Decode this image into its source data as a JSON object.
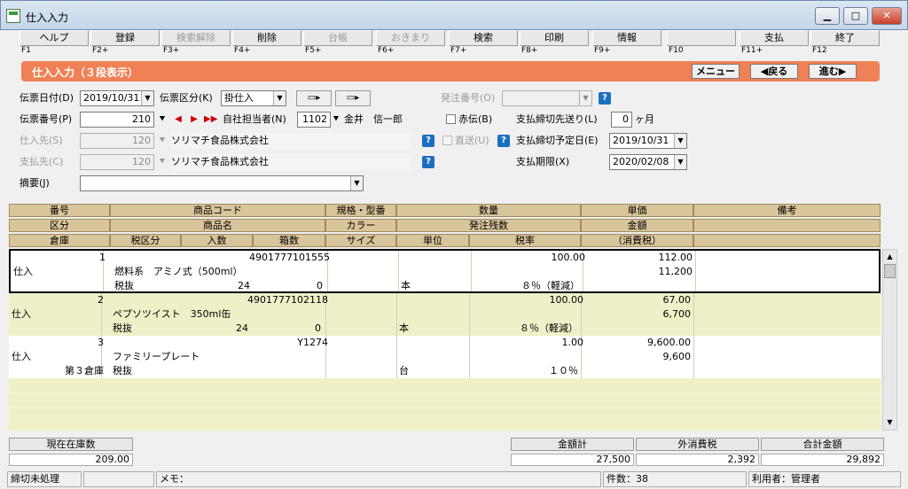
{
  "window": {
    "title": "仕入入力"
  },
  "fkeys": [
    {
      "label": "ヘルプ",
      "key": "F1",
      "enabled": true
    },
    {
      "label": "登録",
      "key": "F2+",
      "enabled": true
    },
    {
      "label": "検索解除",
      "key": "F3+",
      "enabled": false
    },
    {
      "label": "削除",
      "key": "F4+",
      "enabled": true
    },
    {
      "label": "台帳",
      "key": "F5+",
      "enabled": false
    },
    {
      "label": "おきまり",
      "key": "F6+",
      "enabled": false
    },
    {
      "label": "検索",
      "key": "F7+",
      "enabled": true
    },
    {
      "label": "印刷",
      "key": "F8+",
      "enabled": true
    },
    {
      "label": "情報",
      "key": "F9+",
      "enabled": true
    },
    {
      "label": "",
      "key": "F10",
      "enabled": true
    },
    {
      "label": "支払",
      "key": "F11+",
      "enabled": true
    },
    {
      "label": "終了",
      "key": "F12",
      "enabled": true
    }
  ],
  "banner": {
    "title": "仕入入力（３段表示）",
    "menu": "メニュー",
    "back": "◀戻る",
    "next": "進む▶"
  },
  "form": {
    "slip_date_label": "伝票日付(D)",
    "slip_date": "2019/10/31",
    "slip_type_label": "伝票区分(K)",
    "slip_type": "掛仕入",
    "order_no_label": "発注番号(O)",
    "order_no": "",
    "slip_no_label": "伝票番号(P)",
    "slip_no": "210",
    "staff_label": "自社担当者(N)",
    "staff_code": "1102",
    "staff_name": "金井　信一郎",
    "red_label": "赤伝(B)",
    "cutoff_shift_label": "支払締切先送り(L)",
    "cutoff_shift": "0",
    "cutoff_unit": "ヶ月",
    "supplier_label": "仕入先(S)",
    "supplier_code": "120",
    "supplier_name": "ソリマチ食品株式会社",
    "direct_label": "直送(U)",
    "cutoff_date_label": "支払締切予定日(E)",
    "cutoff_date": "2019/10/31",
    "payee_label": "支払先(C)",
    "payee_code": "120",
    "payee_name": "ソリマチ食品株式会社",
    "pay_due_label": "支払期限(X)",
    "pay_due": "2020/02/08",
    "memo_label": "摘要(J)",
    "memo": ""
  },
  "grid_headers": {
    "row1": [
      "番号",
      "商品コード",
      "規格・型番",
      "数量",
      "単価",
      "備考"
    ],
    "row2": [
      "区分",
      "商品名",
      "カラー",
      "発注残数",
      "金額"
    ],
    "row3": [
      "倉庫",
      "税区分",
      "入数",
      "箱数",
      "サイズ",
      "単位",
      "税率",
      "（消費税）"
    ]
  },
  "rows": [
    {
      "no": "1",
      "code": "4901777101555",
      "qty": "100.00",
      "price": "112.00",
      "kind": "仕入",
      "name": "燃料系　アミノ式（500ml）",
      "amount": "11,200",
      "warehouse": "",
      "tax_kind": "税抜",
      "per_box": "24",
      "boxes": "0",
      "unit": "本",
      "tax_rate": "８％（軽減）"
    },
    {
      "no": "2",
      "code": "4901777102118",
      "qty": "100.00",
      "price": "67.00",
      "kind": "仕入",
      "name": "ペプソツイスト　350ml缶",
      "amount": "6,700",
      "warehouse": "",
      "tax_kind": "税抜",
      "per_box": "24",
      "boxes": "0",
      "unit": "本",
      "tax_rate": "８％（軽減）"
    },
    {
      "no": "3",
      "code": "Y1274",
      "qty": "1.00",
      "price": "9,600.00",
      "kind": "仕入",
      "name": "ファミリープレート",
      "amount": "9,600",
      "warehouse": "第３倉庫",
      "tax_kind": "税抜",
      "per_box": "",
      "boxes": "",
      "unit": "台",
      "tax_rate": "１０％"
    }
  ],
  "summary": {
    "stock_label": "現在在庫数",
    "stock": "209.00",
    "amount_total_label": "金額計",
    "amount_total": "27,500",
    "ext_tax_label": "外消費税",
    "ext_tax": "2,392",
    "grand_total_label": "合計金額",
    "grand_total": "29,892"
  },
  "status": {
    "state": "締切未処理",
    "memo_label": "メモ：",
    "count": "件数：38",
    "user": "利用者：管理者"
  }
}
